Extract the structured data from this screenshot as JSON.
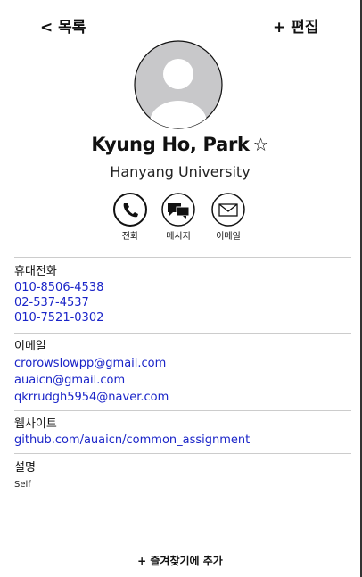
{
  "header": {
    "back_label": "< 목록",
    "edit_label": "+ 편집"
  },
  "contact": {
    "name": "Kyung Ho, Park",
    "star": "☆",
    "organization": "Hanyang University"
  },
  "actions": [
    {
      "label": "전화",
      "icon": "phone-icon"
    },
    {
      "label": "메시지",
      "icon": "message-icon"
    },
    {
      "label": "이메일",
      "icon": "mail-icon"
    }
  ],
  "phones": {
    "title": "휴대전화",
    "items": [
      "010-8506-4538",
      "02-537-4537",
      "010-7521-0302"
    ]
  },
  "emails": {
    "title": "이메일",
    "items": [
      "crorowslowpp@gmail.com",
      "auaicn@gmail.com",
      "qkrrudgh5954@naver.com"
    ]
  },
  "website": {
    "title": "웹사이트",
    "url": "github.com/auaicn/common_assignment"
  },
  "memo": {
    "title": "설명",
    "text": "Self"
  },
  "footer": {
    "favorite_label": "+ 즐겨찾기에 추가"
  },
  "colors": {
    "link": "#1a24c8",
    "divider": "#cccccc",
    "avatar_bg": "#c8c8ca"
  }
}
